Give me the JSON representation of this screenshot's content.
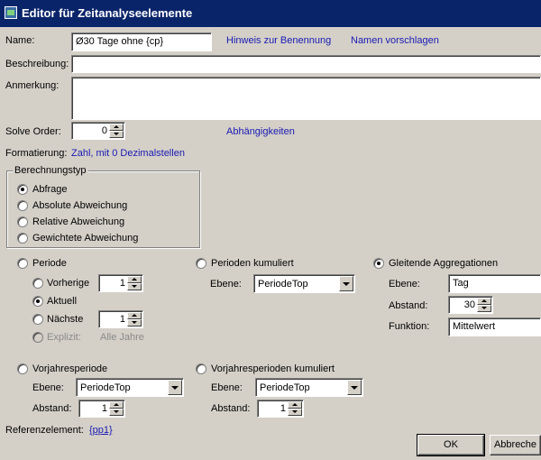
{
  "window": {
    "title": "Editor für Zeitanalyseelemente"
  },
  "name": {
    "label": "Name:",
    "value": "Ø30 Tage ohne {cp}",
    "hint_link": "Hinweis zur Benennung",
    "suggest_link": "Namen vorschlagen"
  },
  "description": {
    "label": "Beschreibung:",
    "value": ""
  },
  "note": {
    "label": "Anmerkung:",
    "value": ""
  },
  "solve_order": {
    "label": "Solve Order:",
    "value": "0",
    "dependencies_link": "Abhängigkeiten"
  },
  "formatting": {
    "label": "Formatierung:",
    "value": "Zahl, mit 0 Dezimalstellen"
  },
  "calc_type": {
    "title": "Berechnungstyp",
    "options": [
      "Abfrage",
      "Absolute Abweichung",
      "Relative Abweichung",
      "Gewichtete Abweichung"
    ],
    "selected": "Abfrage"
  },
  "periode": {
    "label": "Periode",
    "previous": {
      "label": "Vorherige",
      "value": "1"
    },
    "current": {
      "label": "Aktuell"
    },
    "next": {
      "label": "Nächste",
      "value": "1"
    },
    "explicit": {
      "label": "Explizit:",
      "value": "Alle Jahre"
    }
  },
  "perioden_kumuliert": {
    "label": "Perioden kumuliert",
    "level_label": "Ebene:",
    "level_value": "PeriodeTop"
  },
  "gleitende": {
    "label": "Gleitende Aggregationen",
    "level_label": "Ebene:",
    "level_value": "Tag",
    "distance_label": "Abstand:",
    "distance_value": "30",
    "function_label": "Funktion:",
    "function_value": "Mittelwert"
  },
  "vorjahresperiode": {
    "label": "Vorjahresperiode",
    "level_label": "Ebene:",
    "level_value": "PeriodeTop",
    "distance_label": "Abstand:",
    "distance_value": "1"
  },
  "vorjahresperioden_kumuliert": {
    "label": "Vorjahresperioden kumuliert",
    "level_label": "Ebene:",
    "level_value": "PeriodeTop",
    "distance_label": "Abstand:",
    "distance_value": "1"
  },
  "reference": {
    "label": "Referenzelement:",
    "value": "{pp1}"
  },
  "buttons": {
    "ok": "OK",
    "cancel": "Abbreche"
  }
}
